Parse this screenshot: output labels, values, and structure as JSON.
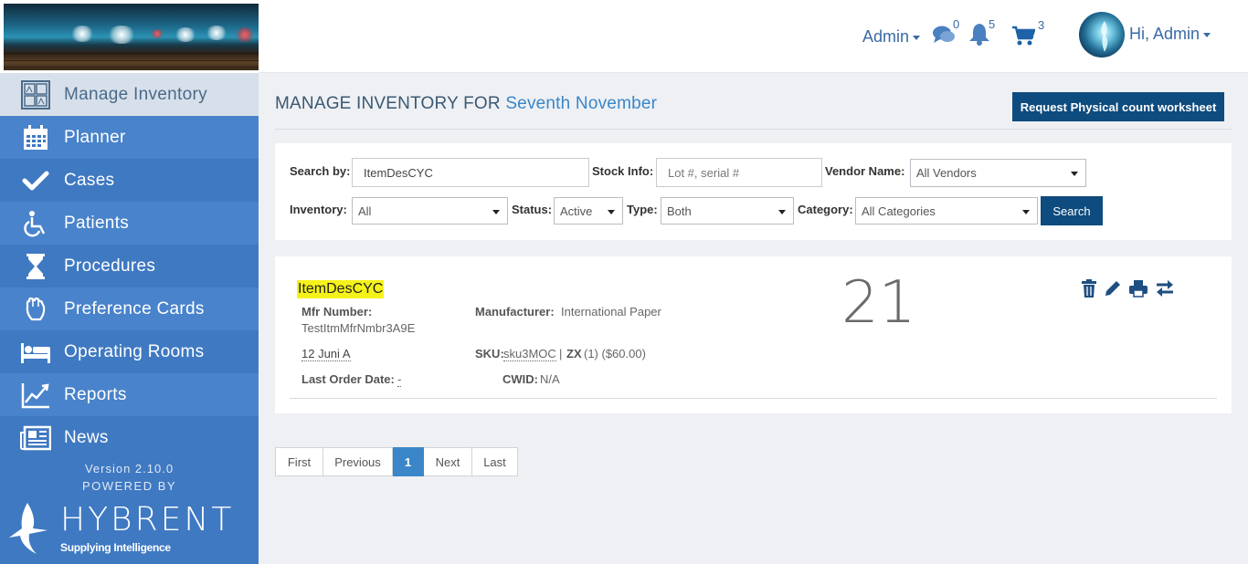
{
  "header": {
    "admin_menu": "Admin",
    "messages_count": "0",
    "notifications_count": "5",
    "cart_count": "3",
    "greeting": "Hi, Admin"
  },
  "sidebar": {
    "items": [
      {
        "label": "Manage Inventory",
        "icon": "inventory-grid-icon",
        "active": true
      },
      {
        "label": "Planner",
        "icon": "calendar-icon"
      },
      {
        "label": "Cases",
        "icon": "check-icon"
      },
      {
        "label": "Patients",
        "icon": "wheelchair-icon"
      },
      {
        "label": "Procedures",
        "icon": "hourglass-icon"
      },
      {
        "label": "Preference Cards",
        "icon": "hand-icon"
      },
      {
        "label": "Operating Rooms",
        "icon": "bed-icon"
      },
      {
        "label": "Reports",
        "icon": "line-chart-icon"
      },
      {
        "label": "News",
        "icon": "newspaper-icon"
      }
    ],
    "version": "Version 2.10.0",
    "powered_by": "POWERED BY",
    "logo_word": "HYBRENT",
    "logo_tagline": "Supplying Intelligence"
  },
  "page": {
    "title_prefix": "MANAGE INVENTORY FOR",
    "title_location": "Seventh November",
    "request_button": "Request Physical count worksheet"
  },
  "filters": {
    "search_by_label": "Search by:",
    "search_by_value": "ItemDesCYC",
    "stock_info_label": "Stock Info:",
    "stock_info_placeholder": "Lot #, serial #",
    "vendor_label": "Vendor Name:",
    "vendor_value": "All Vendors",
    "inventory_label": "Inventory:",
    "inventory_value": "All",
    "status_label": "Status:",
    "status_value": "Active",
    "type_label": "Type:",
    "type_value": "Both",
    "category_label": "Category:",
    "category_value": "All Categories",
    "search_button": "Search"
  },
  "item": {
    "name": "ItemDesCYC",
    "mfr_number_label": "Mfr Number:",
    "mfr_number": "TestItmMfrNmbr3A9E",
    "manufacturer_label": "Manufacturer:",
    "manufacturer": "International Paper",
    "location": "12 Juni A",
    "sku_label": "SKU:",
    "sku": "sku3MOC",
    "sku_sep": "|",
    "uom": "ZX",
    "uom_detail": "(1) ($60.00)",
    "last_order_label": "Last Order Date:",
    "last_order": "-",
    "cwid_label": "CWID:",
    "cwid": "N/A",
    "count": "21",
    "actions": [
      "trash-icon",
      "pencil-icon",
      "print-icon",
      "transfer-icon"
    ]
  },
  "pagination": {
    "first": "First",
    "previous": "Previous",
    "current": "1",
    "next": "Next",
    "last": "Last"
  },
  "colors": {
    "sidebar_blue": "#3f79c2",
    "primary_button": "#0e4b7e",
    "link_blue": "#3a86c8",
    "highlight": "#f5f21a"
  }
}
